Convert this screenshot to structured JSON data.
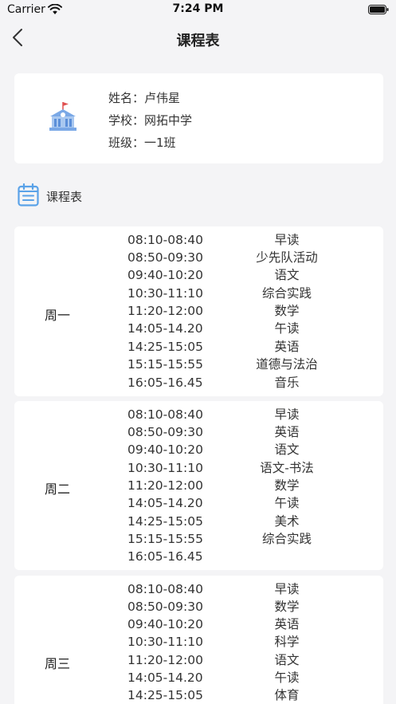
{
  "status": {
    "carrier": "Carrier",
    "time": "7:24 PM"
  },
  "nav": {
    "title": "课程表"
  },
  "student": {
    "name_label": "姓名：",
    "name": "卢伟星",
    "school_label": "学校：",
    "school": "网拓中学",
    "class_label": "班级：",
    "class": "一1班"
  },
  "section": {
    "title": "课程表"
  },
  "schedule": [
    {
      "day": "周一",
      "slots": [
        {
          "time": "08:10-08:40",
          "subject": "早读"
        },
        {
          "time": "08:50-09:30",
          "subject": "少先队活动"
        },
        {
          "time": "09:40-10:20",
          "subject": "语文"
        },
        {
          "time": "10:30-11:10",
          "subject": "综合实践"
        },
        {
          "time": "11:20-12:00",
          "subject": "数学"
        },
        {
          "time": "14:05-14.20",
          "subject": "午读"
        },
        {
          "time": "14:25-15:05",
          "subject": "英语"
        },
        {
          "time": "15:15-15:55",
          "subject": "道德与法治"
        },
        {
          "time": "16:05-16.45",
          "subject": "音乐"
        }
      ]
    },
    {
      "day": "周二",
      "slots": [
        {
          "time": "08:10-08:40",
          "subject": "早读"
        },
        {
          "time": "08:50-09:30",
          "subject": "英语"
        },
        {
          "time": "09:40-10:20",
          "subject": "语文"
        },
        {
          "time": "10:30-11:10",
          "subject": "语文-书法"
        },
        {
          "time": "11:20-12:00",
          "subject": "数学"
        },
        {
          "time": "14:05-14.20",
          "subject": "午读"
        },
        {
          "time": "14:25-15:05",
          "subject": "美术"
        },
        {
          "time": "15:15-15:55",
          "subject": "综合实践"
        },
        {
          "time": "16:05-16.45",
          "subject": ""
        }
      ]
    },
    {
      "day": "周三",
      "slots": [
        {
          "time": "08:10-08:40",
          "subject": "早读"
        },
        {
          "time": "08:50-09:30",
          "subject": "数学"
        },
        {
          "time": "09:40-10:20",
          "subject": "英语"
        },
        {
          "time": "10:30-11:10",
          "subject": "科学"
        },
        {
          "time": "11:20-12:00",
          "subject": "语文"
        },
        {
          "time": "14:05-14.20",
          "subject": "午读"
        },
        {
          "time": "14:25-15:05",
          "subject": "体育"
        }
      ]
    }
  ],
  "colors": {
    "accent": "#5aa2e8",
    "background": "#f4f4f6",
    "card": "#ffffff"
  }
}
